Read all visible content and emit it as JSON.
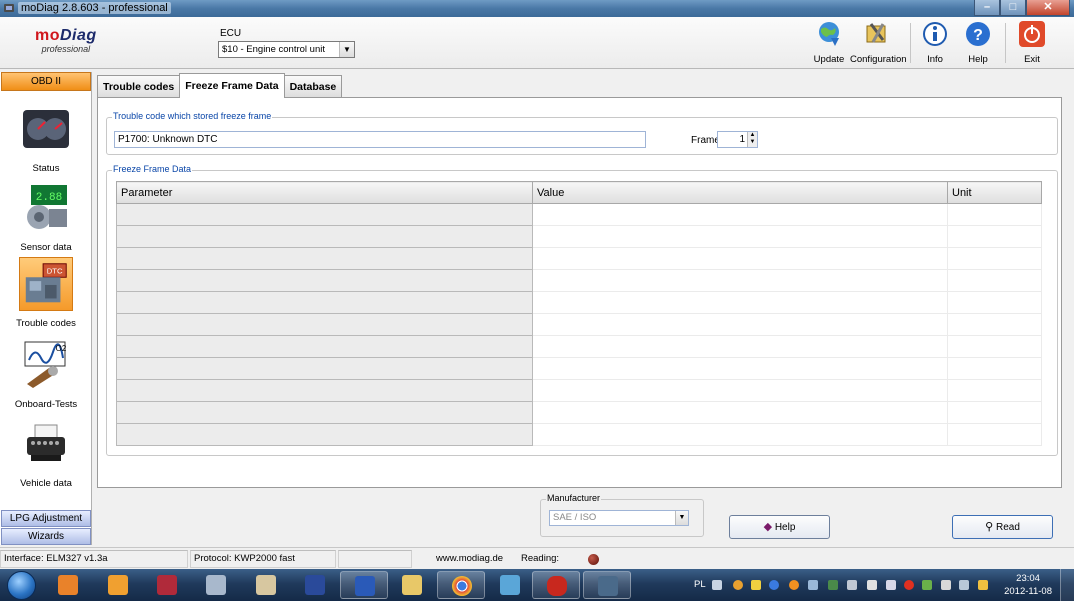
{
  "window": {
    "title": "moDiag 2.8.603 - professional"
  },
  "logo": {
    "brand_mo": "mo",
    "brand_diag": "Diag",
    "edition": "professional"
  },
  "ecu": {
    "label": "ECU",
    "selected": "$10 - Engine control unit"
  },
  "toolbar": {
    "update": "Update",
    "configuration": "Configuration",
    "info": "Info",
    "help": "Help",
    "exit": "Exit"
  },
  "nav": {
    "obd": "OBD II",
    "items": [
      {
        "label": "Status",
        "icon": "gauge-icon"
      },
      {
        "label": "Sensor data",
        "icon": "sensor-icon"
      },
      {
        "label": "Trouble codes",
        "icon": "engine-icon",
        "selected": true
      },
      {
        "label": "Onboard-Tests",
        "icon": "o2-sensor-icon"
      },
      {
        "label": "Vehicle data",
        "icon": "typewriter-icon"
      }
    ],
    "lpg": "LPG Adjustment",
    "wizards": "Wizards"
  },
  "tabs": [
    {
      "label": "Trouble codes",
      "active": false
    },
    {
      "label": "Freeze Frame Data",
      "active": true
    },
    {
      "label": "Database",
      "active": false
    }
  ],
  "trouble_group": {
    "legend": "Trouble code which stored freeze frame",
    "code_value": "P1700: Unknown DTC",
    "frame_label": "Frame",
    "frame_value": "1"
  },
  "freeze_group": {
    "legend": "Freeze Frame Data",
    "columns": [
      "Parameter",
      "Value",
      "Unit"
    ],
    "row_count": 11
  },
  "manufacturer": {
    "legend": "Manufacturer",
    "selected": "SAE / ISO"
  },
  "buttons": {
    "help": "Help",
    "read": "Read"
  },
  "status": {
    "interface": "Interface: ELM327 v1.3a",
    "protocol": "Protocol: KWP2000 fast",
    "website": "www.modiag.de",
    "reading": "Reading:"
  },
  "taskbar": {
    "language": "PL",
    "time": "23:04",
    "date": "2012-11-08"
  },
  "colors": {
    "accent": "#f08e16",
    "legend": "#0a46a8",
    "brand_red": "#d0161c",
    "brand_navy": "#1d2b6b"
  }
}
